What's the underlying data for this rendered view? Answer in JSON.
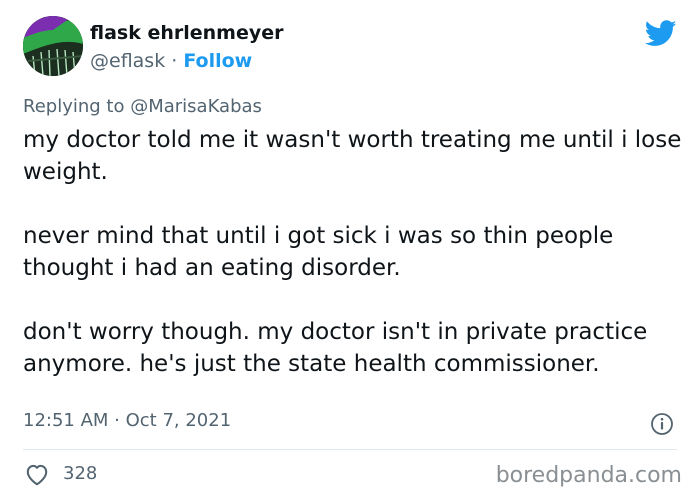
{
  "author": {
    "name": "flask ehrlenmeyer",
    "handle": "@eflask",
    "separator": " · ",
    "follow_label": "Follow"
  },
  "reply_context": {
    "prefix": "Replying to ",
    "handle": "@MarisaKabas"
  },
  "tweet": {
    "paragraphs": [
      "my doctor told me it wasn't worth treating me until i lose weight.",
      "never mind that until i got sick i was so thin people thought i had an eating disorder.",
      "don't worry though. my doctor isn't in private practice anymore. he's just the state health commissioner."
    ],
    "timestamp": "12:51 AM · Oct 7, 2021"
  },
  "engagement": {
    "like_count": "328"
  },
  "watermark": "boredpanda.com",
  "colors": {
    "accent": "#1d9bf0",
    "secondary_text": "#536471",
    "primary_text": "#0f1419"
  },
  "icons": {
    "brand": "twitter-bird-icon",
    "info": "info-icon",
    "like": "heart-icon"
  }
}
